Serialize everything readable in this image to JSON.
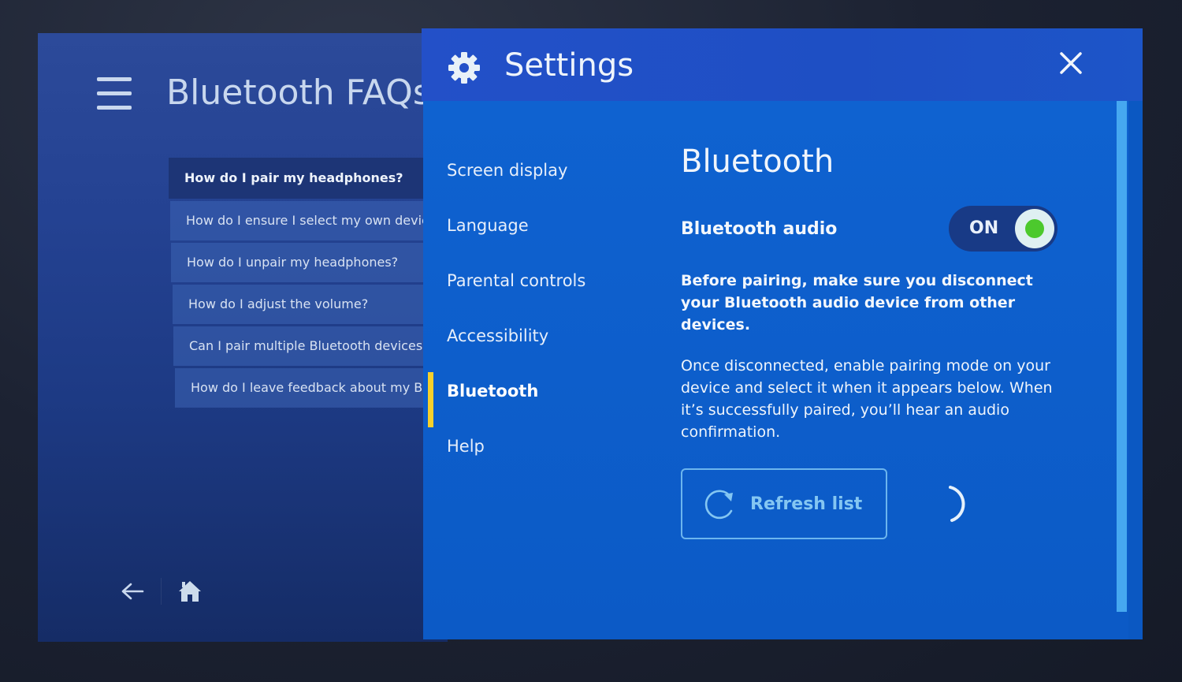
{
  "faq_screen": {
    "title": "Bluetooth FAQs",
    "menu_icon": "hamburger-menu-icon",
    "items": [
      {
        "label": "How do I pair my headphones?",
        "active": true
      },
      {
        "label": "How do I ensure I select my own device?",
        "active": false
      },
      {
        "label": "How do I unpair my headphones?",
        "active": false
      },
      {
        "label": "How do I adjust the volume?",
        "active": false
      },
      {
        "label": "Can I pair multiple Bluetooth devices to",
        "active": false
      },
      {
        "label": "How do I leave feedback about my Bluetooth",
        "active": false
      }
    ],
    "bottom_nav": {
      "back_icon": "arrow-left-icon",
      "home_icon": "home-icon"
    }
  },
  "settings": {
    "title": "Settings",
    "header_icon": "gear-icon",
    "close_icon": "close-icon",
    "nav": [
      {
        "label": "Screen display",
        "active": false
      },
      {
        "label": "Language",
        "active": false
      },
      {
        "label": "Parental controls",
        "active": false
      },
      {
        "label": "Accessibility",
        "active": false
      },
      {
        "label": "Bluetooth",
        "active": true
      },
      {
        "label": "Help",
        "active": false
      }
    ],
    "content": {
      "title": "Bluetooth",
      "audio_label": "Bluetooth audio",
      "toggle_state": "ON",
      "toggle_on": true,
      "warning": "Before pairing, make sure you disconnect your Bluetooth audio device from other devices.",
      "info": "Once disconnected, enable pairing mode on your device and select it when it appears below. When it’s successfully paired, you’ll hear an audio confirmation.",
      "refresh_label": "Refresh list",
      "refresh_icon": "refresh-icon",
      "loading_icon": "loading-spinner-icon"
    }
  },
  "colors": {
    "accent_yellow": "#f5d02c",
    "toggle_green": "#4cc92d",
    "header_blue": "#2350c8",
    "body_blue": "#0f62d0",
    "faq_bg": "#244292",
    "scroll_thumb": "#46a8f0"
  }
}
